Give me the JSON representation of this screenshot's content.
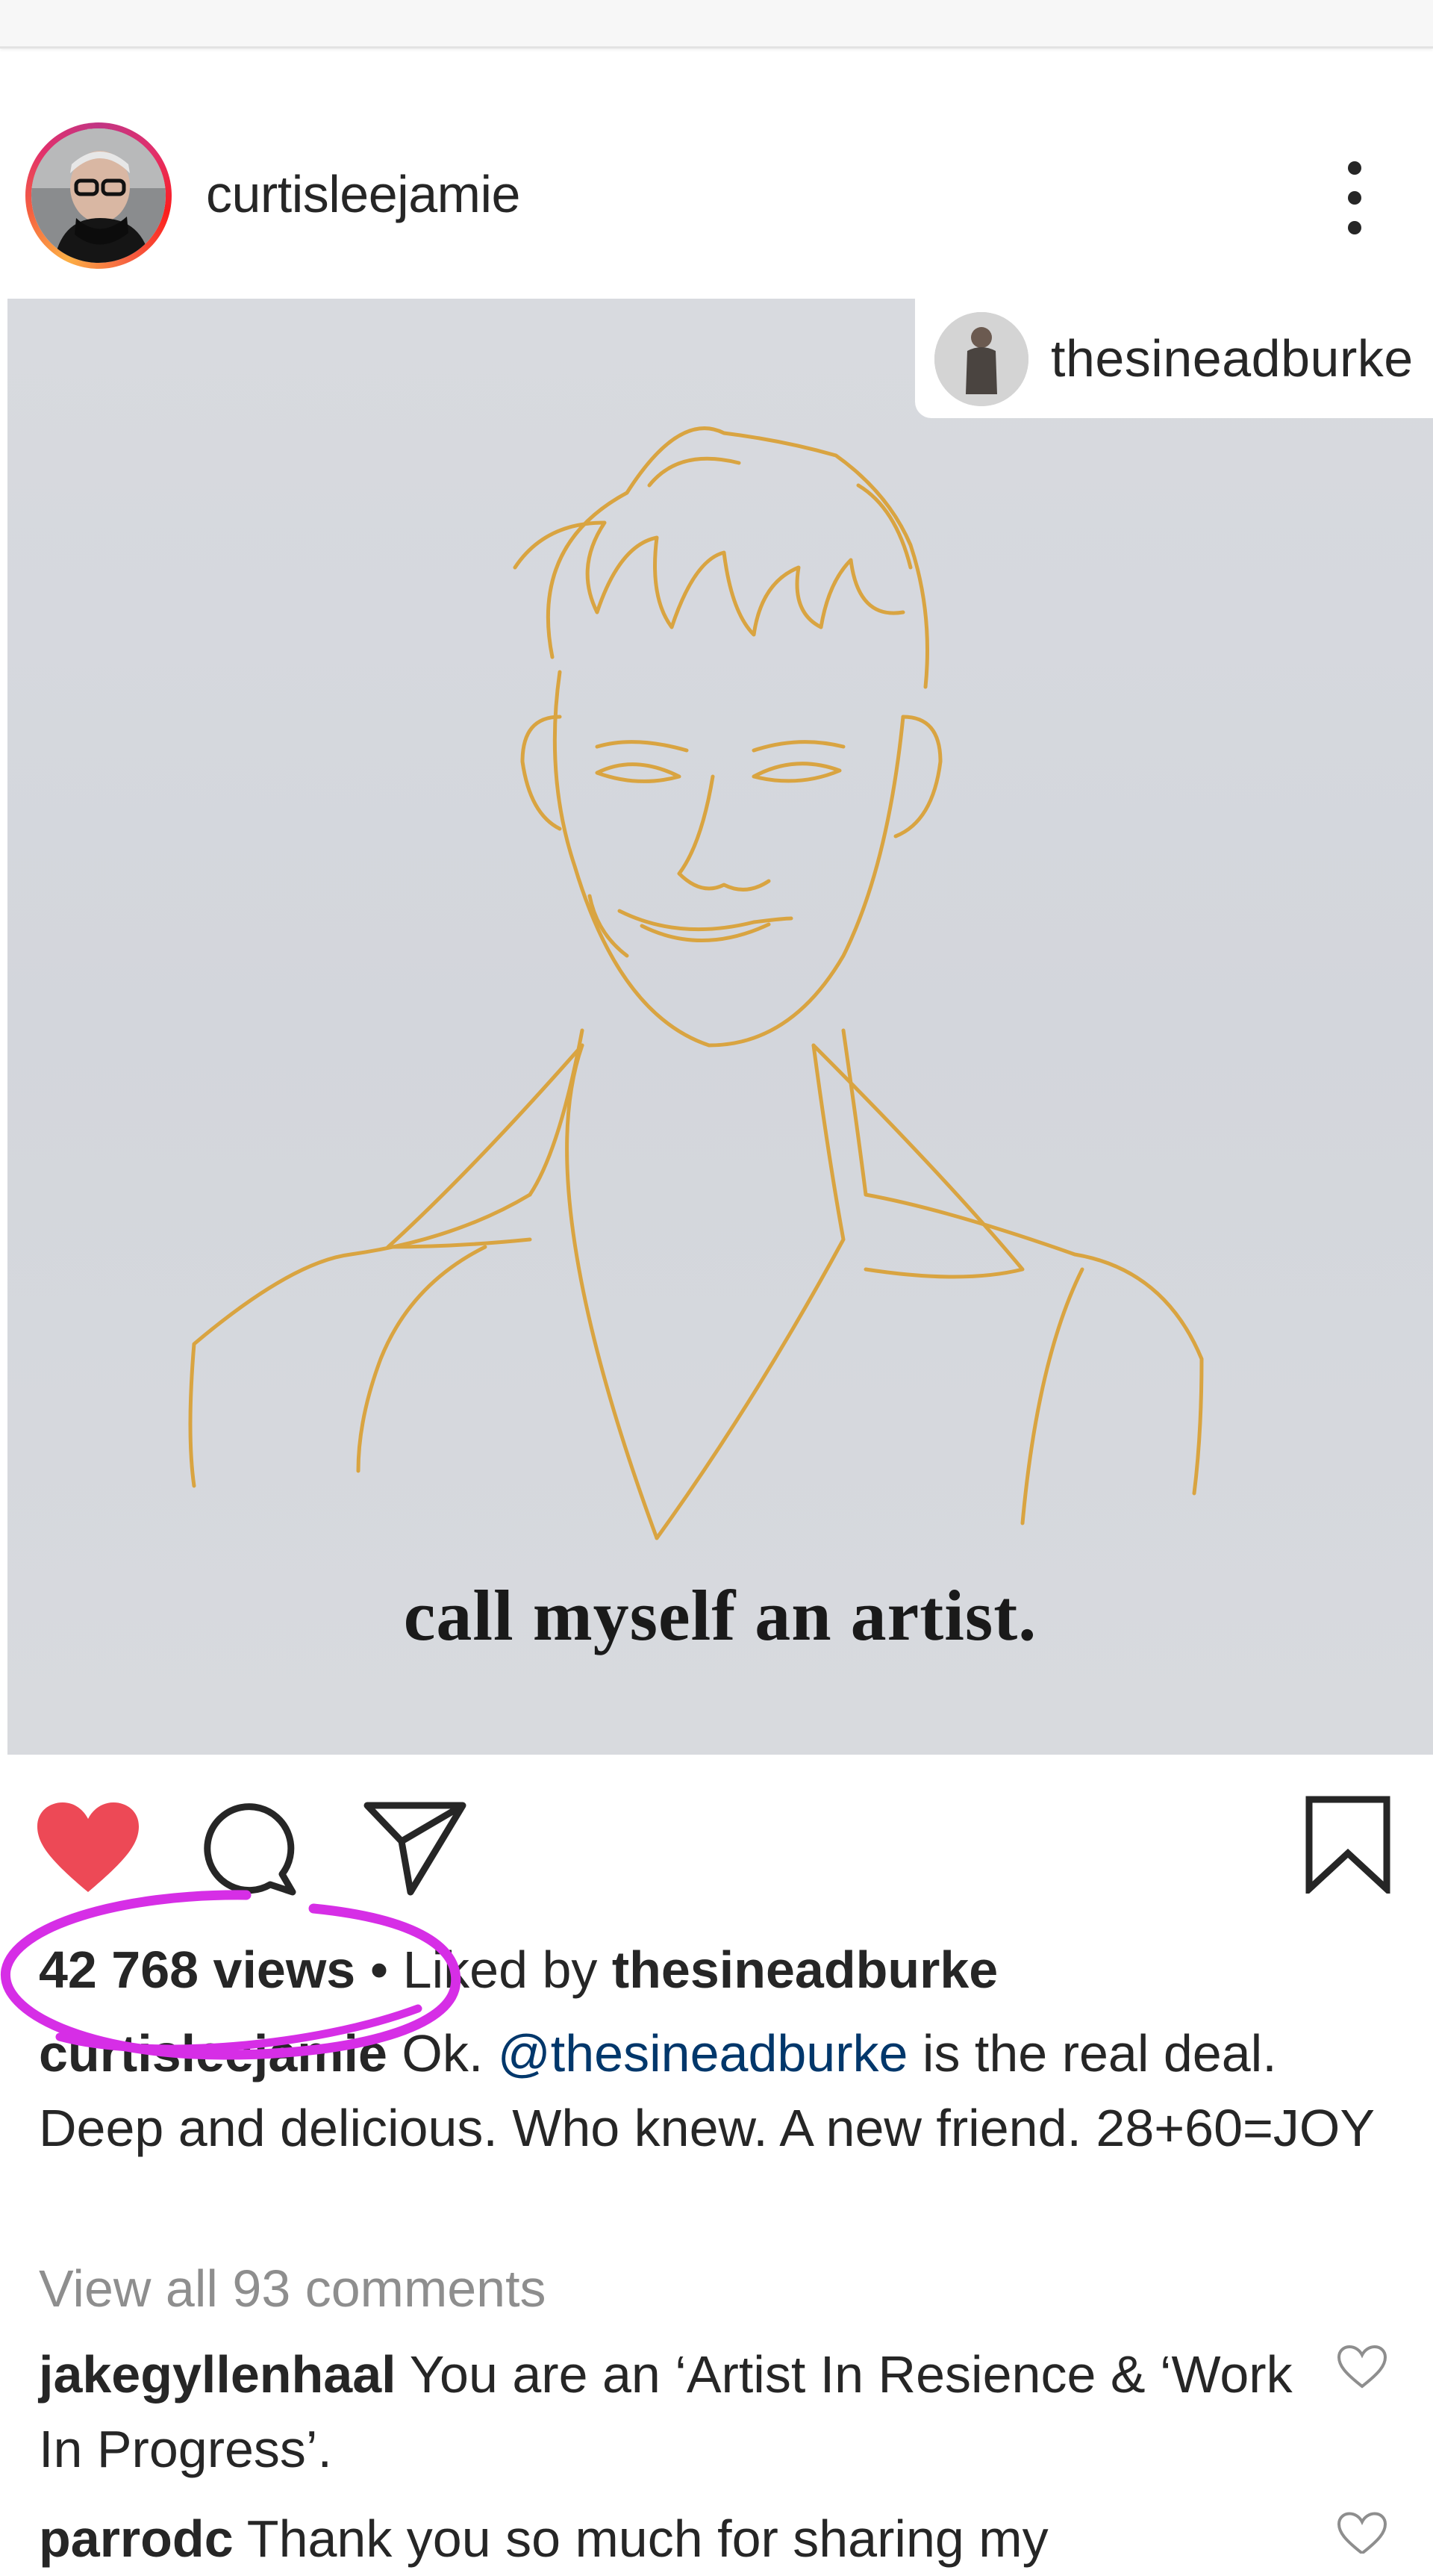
{
  "post": {
    "author": "curtisleejamie",
    "tagged_user": "thesineadburke",
    "media_caption_text": "call myself an artist.",
    "views": "42 768 views",
    "separator": "•",
    "liked_by_prefix": "Liked by",
    "liked_by_user": "thesineadburke",
    "caption": {
      "author": "curtisleejamie",
      "text_before_mention": " Ok. ",
      "mention": "@thesineadburke",
      "text_after_mention": " is the real deal. Deep and delicious. Who knew. A new friend. 28+60=JOY"
    },
    "view_all_comments": "View all 93 comments",
    "comments": [
      {
        "user": "jakegyllenhaal",
        "text": " You are an ‘Artist In Resience & ‘Work In Progress’."
      },
      {
        "user": "parrodc",
        "text": " Thank you so much for sharing my"
      }
    ]
  },
  "icons": {
    "like": "heart-filled-icon",
    "comment": "comment-bubble-icon",
    "share": "paper-plane-icon",
    "save": "bookmark-icon",
    "more": "more-vertical-icon",
    "comment_like": "heart-outline-icon"
  },
  "colors": {
    "like_red": "#ed4956",
    "mention_blue": "#00376b",
    "muted_gray": "#8e8e8e",
    "annotation_magenta": "#d62ee6",
    "line_art_gold": "#d9a441"
  }
}
